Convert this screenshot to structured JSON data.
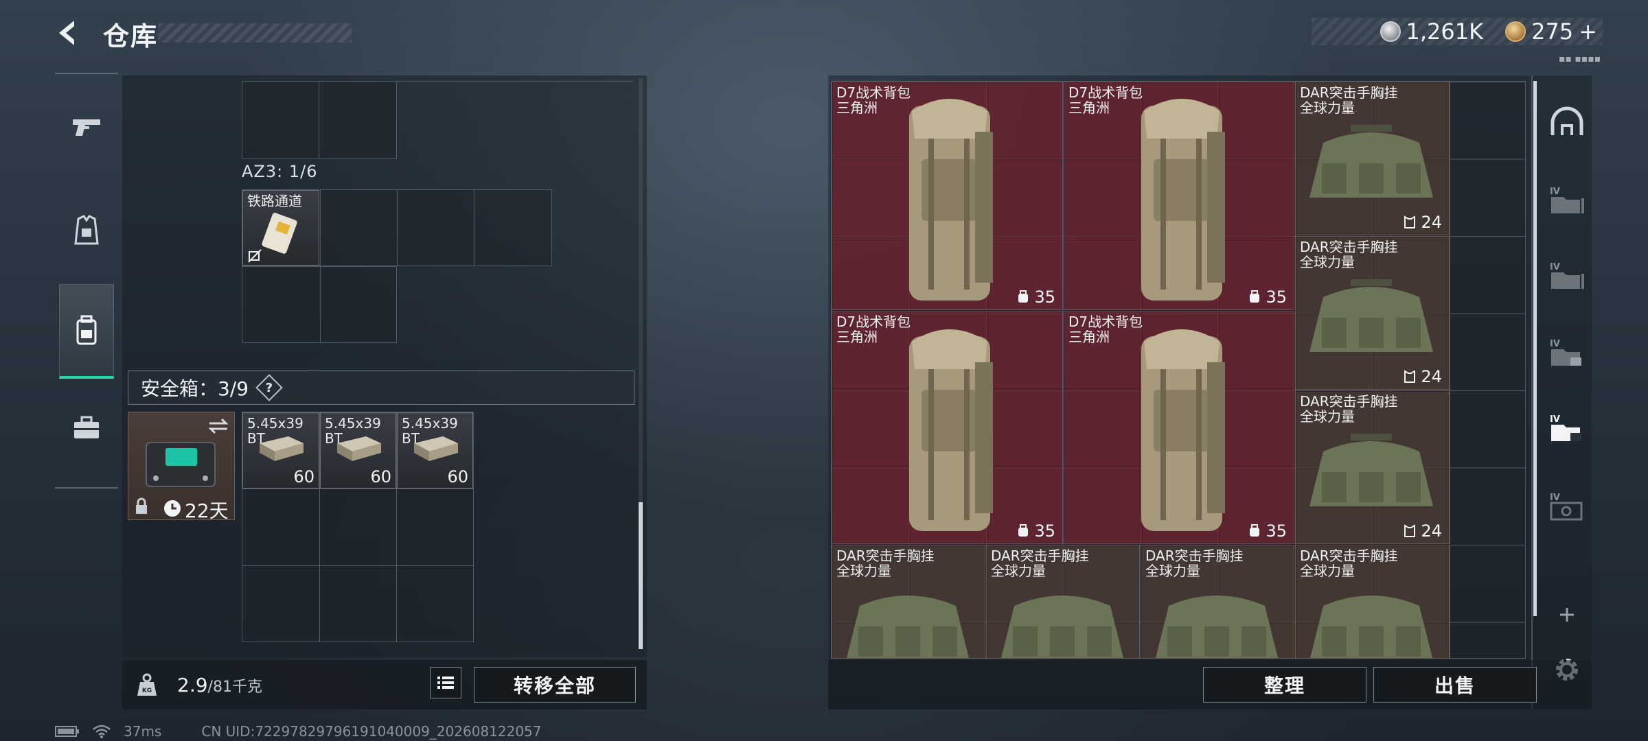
{
  "header": {
    "title": "仓库",
    "currency": [
      {
        "icon": "silver-coin-icon",
        "value": "1,261K"
      },
      {
        "icon": "gold-coin-icon",
        "value": "275"
      },
      {
        "icon": "plus-icon",
        "value": "+"
      }
    ]
  },
  "left_nav": {
    "items": [
      {
        "name": "weapons",
        "icon": "pistol-icon",
        "active": false
      },
      {
        "name": "equipment",
        "icon": "vest-icon",
        "active": false
      },
      {
        "name": "backpack",
        "icon": "backpack-icon",
        "active": true
      },
      {
        "name": "case",
        "icon": "briefcase-icon",
        "active": false
      }
    ]
  },
  "loadout": {
    "az_label": "AZ3: 1/6",
    "az_item": {
      "name": "铁路通道",
      "icon": "keycard-icon"
    },
    "safe_box": {
      "label": "安全箱：3/9",
      "help": "?",
      "timer": "22天",
      "items": [
        {
          "name": "5.45x39 BT",
          "count": "60"
        },
        {
          "name": "5.45x39 BT",
          "count": "60"
        },
        {
          "name": "5.45x39 BT",
          "count": "60"
        }
      ]
    }
  },
  "bottom_left": {
    "weight_value": "2.9",
    "weight_max": "/81千克",
    "transfer_all_label": "转移全部"
  },
  "stash": {
    "items": [
      {
        "name": "D7战术背包",
        "sub": "三角洲",
        "stat": "35",
        "stat_icon": "backpack-capacity-icon",
        "color": "red"
      },
      {
        "name": "D7战术背包",
        "sub": "三角洲",
        "stat": "35",
        "stat_icon": "backpack-capacity-icon",
        "color": "red"
      },
      {
        "name": "DAR突击手胸挂",
        "sub": "全球力量",
        "stat": "24",
        "stat_icon": "vest-capacity-icon",
        "color": "brown"
      },
      {
        "name": "DAR突击手胸挂",
        "sub": "全球力量",
        "stat": "24",
        "stat_icon": "vest-capacity-icon",
        "color": "brown"
      },
      {
        "name": "D7战术背包",
        "sub": "三角洲",
        "stat": "35",
        "stat_icon": "backpack-capacity-icon",
        "color": "red"
      },
      {
        "name": "D7战术背包",
        "sub": "三角洲",
        "stat": "35",
        "stat_icon": "backpack-capacity-icon",
        "color": "red"
      },
      {
        "name": "DAR突击手胸挂",
        "sub": "全球力量",
        "stat": "24",
        "stat_icon": "vest-capacity-icon",
        "color": "brown"
      },
      {
        "name": "DAR突击手胸挂",
        "sub": "全球力量",
        "stat": "",
        "stat_icon": "",
        "color": "brown"
      },
      {
        "name": "DAR突击手胸挂",
        "sub": "全球力量",
        "stat": "",
        "stat_icon": "",
        "color": "brown"
      },
      {
        "name": "DAR突击手胸挂",
        "sub": "全球力量",
        "stat": "",
        "stat_icon": "",
        "color": "brown"
      },
      {
        "name": "DAR突击手胸挂",
        "sub": "全球力量",
        "stat": "",
        "stat_icon": "",
        "color": "brown"
      }
    ],
    "sort_label": "整理",
    "sell_label": "出售"
  },
  "right_rail": {
    "items": [
      "dome-icon",
      "folder-iv-icon",
      "folder-iv-icon",
      "folder-iv-case-icon",
      "folder-iv-case-active-icon",
      "folder-iv-safe-icon",
      "plus-icon"
    ],
    "settings_icon": "gear-icon",
    "top_hint": "▪▪ ▪▪▪▪"
  },
  "status": {
    "ping": "37ms",
    "uid": "CN UID:72297829796191040009_202608122057"
  }
}
